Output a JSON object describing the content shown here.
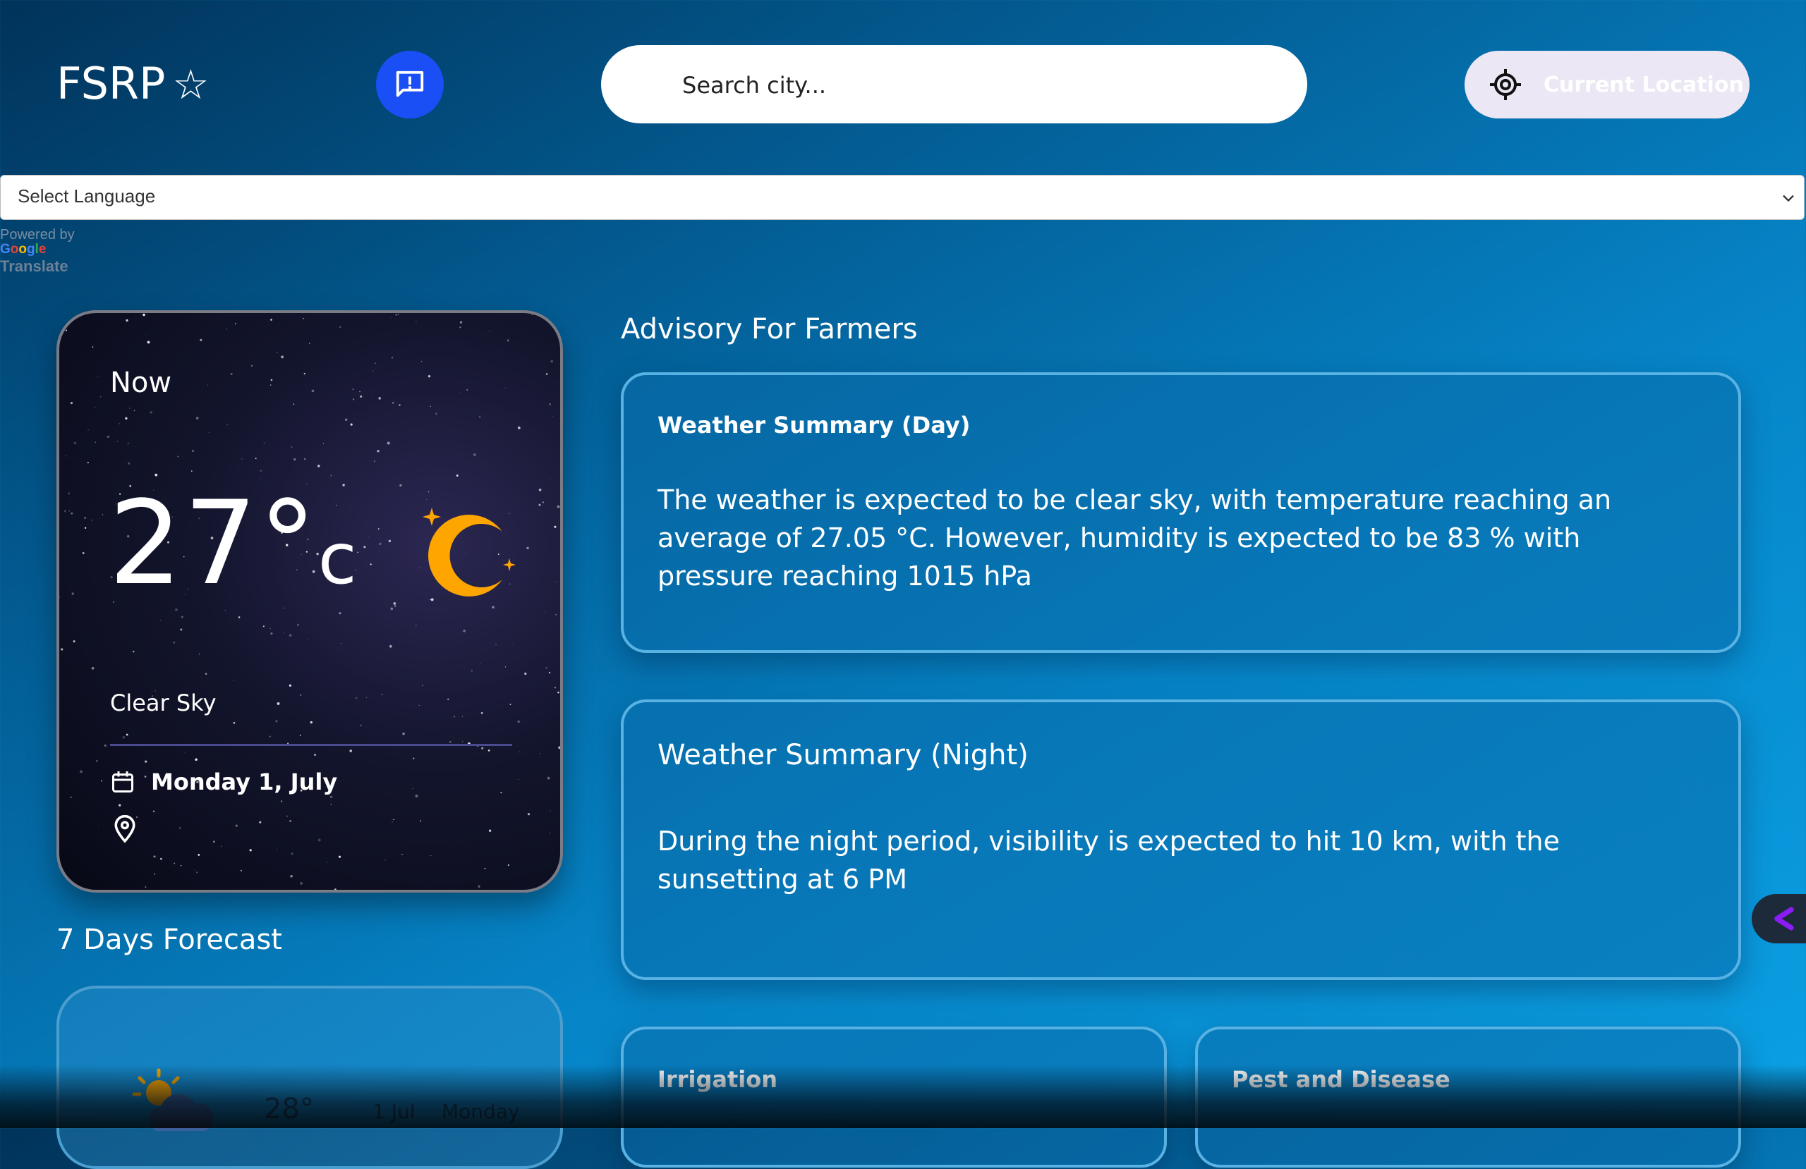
{
  "header": {
    "logo": "FSRP",
    "logo_star": "☆",
    "search_placeholder": "Search city...",
    "location_label": "Current Location"
  },
  "language": {
    "selected": "Select Language",
    "powered_by": "Powered by",
    "google": "Google",
    "translate": "Translate"
  },
  "now": {
    "label": "Now",
    "temp": "27°",
    "unit": "c",
    "condition": "Clear Sky",
    "date": "Monday 1, July",
    "location": ""
  },
  "forecast": {
    "title": "7 Days Forecast",
    "items": [
      {
        "temp": "28°",
        "date": "1 Jul",
        "day": "Monday"
      }
    ]
  },
  "advisory": {
    "title": "Advisory For Farmers",
    "day": {
      "heading": "Weather Summary (Day)",
      "body": "The weather is expected to be clear sky, with temperature reaching an average of 27.05 °C. However, humidity is expected to be 83 % with pressure reaching 1015 hPa"
    },
    "night": {
      "heading": "Weather Summary (Night)",
      "body": "During the night period, visibility is expected to hit 10 km, with the sunsetting at 6 PM"
    },
    "irrigation": {
      "heading": "Irrigation"
    },
    "pest": {
      "heading": "Pest and Disease"
    }
  },
  "colors": {
    "accent_blue": "#1a4ff5",
    "moon": "#ffa500",
    "side_tab_icon": "#8a1cf5"
  }
}
